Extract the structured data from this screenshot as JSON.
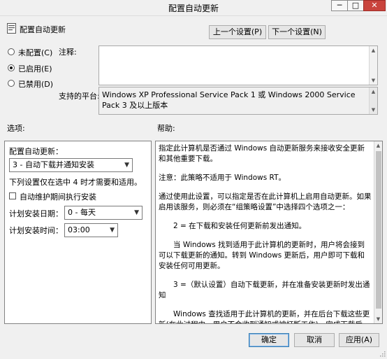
{
  "window": {
    "title": "配置自动更新",
    "minimize": "─",
    "maximize": "□",
    "close": "✕"
  },
  "header": {
    "icon": "policy-icon",
    "policy_name": "配置自动更新",
    "prev_button": "上一个设置(P)",
    "next_button": "下一个设置(N)"
  },
  "state": {
    "options": [
      {
        "label": "未配置(C)",
        "selected": false
      },
      {
        "label": "已启用(E)",
        "selected": true
      },
      {
        "label": "已禁用(D)",
        "selected": false
      }
    ],
    "comment_label": "注释:",
    "platform_label": "支持的平台:",
    "platform_text": "Windows XP Professional Service Pack 1 或 Windows 2000 Service Pack 3 及以上版本"
  },
  "options_section": {
    "label": "选项:",
    "configure_label": "配置自动更新：",
    "configure_value": "3 - 自动下载并通知安装",
    "note": "下列设置仅在选中 4 时才需要和适用。",
    "maintenance_checkbox": "自动维护期间执行安装",
    "day_label": "计划安装日期：",
    "day_value": "0 - 每天",
    "time_label": "计划安装时间：",
    "time_value": "03:00"
  },
  "help_section": {
    "label": "帮助:",
    "paragraphs": [
      "指定此计算机是否通过 Windows 自动更新服务来接收安全更新和其他重要下载。",
      "注意：此策略不适用于 Windows RT。",
      "通过使用此设置，可以指定是否在此计算机上启用自动更新。如果启用该服务，则必须在“组策略设置”中选择四个选项之一：",
      "2 = 在下载和安装任何更新前发出通知。",
      "当 Windows 找到适用于此计算机的更新时，用户将会接到可以下载更新的通知。转到 Windows 更新后，用户即可下载和安装任何可用更新。",
      "3 =（默认设置）自动下载更新，并在准备安装更新时发出通知",
      "Windows 查找适用于此计算机的更新，并在后台下载这些更新(在此过程中，用户不会收到通知或被打断工作)。完成下载后，用户将收到可以安装更新的通知。转到 Windows 更新后，用户即可安装更新。"
    ]
  },
  "footer": {
    "ok": "确定",
    "cancel": "取消",
    "apply": "应用(A)"
  }
}
